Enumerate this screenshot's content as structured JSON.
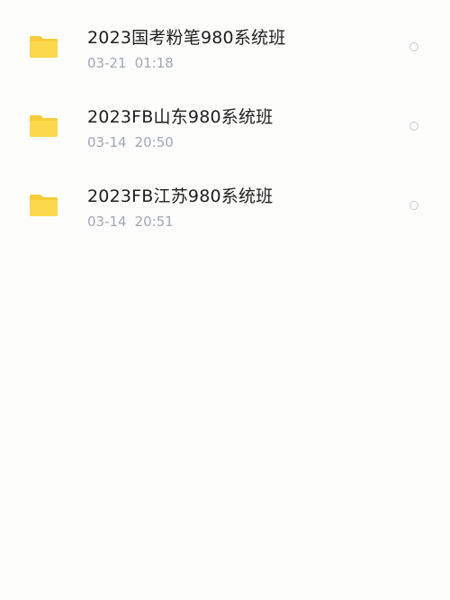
{
  "files": [
    {
      "name": "2023国考粉笔980系统班",
      "date": "03-21",
      "time": "01:18",
      "icon": "folder-icon",
      "selected": false
    },
    {
      "name": "2023FB山东980系统班",
      "date": "03-14",
      "time": "20:50",
      "icon": "folder-icon",
      "selected": false
    },
    {
      "name": "2023FB江苏980系统班",
      "date": "03-14",
      "time": "20:51",
      "icon": "folder-icon",
      "selected": false
    }
  ],
  "colors": {
    "folder": "#fcd94c",
    "folder_tab": "#f7cc3a",
    "background": "#fdfdfc",
    "name_text": "#1f1f1f",
    "date_text": "#a3a8b3",
    "radio_border": "#c7c9ce"
  }
}
